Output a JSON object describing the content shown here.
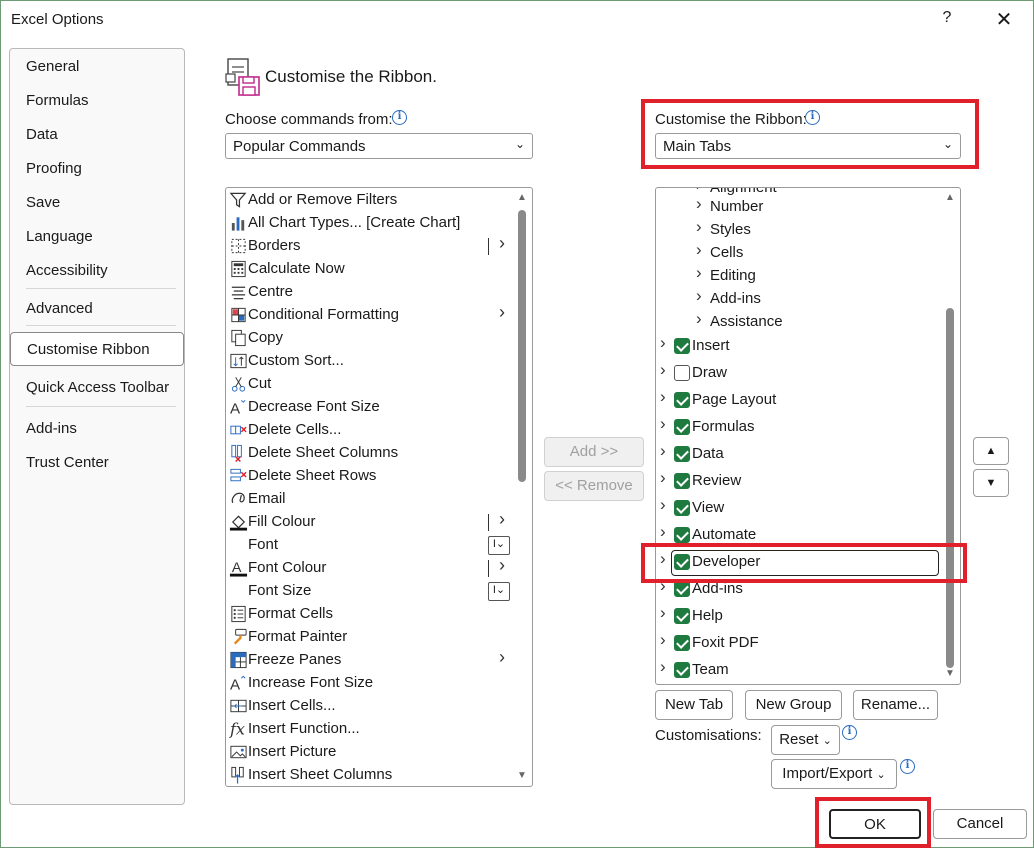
{
  "window": {
    "title": "Excel Options",
    "help": "?",
    "close": "✕"
  },
  "nav": [
    {
      "label": "General",
      "active": false
    },
    {
      "label": "Formulas",
      "active": false
    },
    {
      "label": "Data",
      "active": false
    },
    {
      "label": "Proofing",
      "active": false
    },
    {
      "label": "Save",
      "active": false
    },
    {
      "label": "Language",
      "active": false
    },
    {
      "label": "Accessibility",
      "active": false
    },
    {
      "label": "Advanced",
      "active": false
    },
    {
      "label": "Customise Ribbon",
      "active": true
    },
    {
      "label": "Quick Access Toolbar",
      "active": false
    },
    {
      "label": "Add-ins",
      "active": false
    },
    {
      "label": "Trust Center",
      "active": false
    }
  ],
  "heading": "Customise the Ribbon.",
  "left": {
    "label": "Choose commands from:",
    "dropdown_value": "Popular Commands",
    "commands": [
      {
        "label": "Add or Remove Filters",
        "icon": "filter-icon",
        "suffix": ""
      },
      {
        "label": "All Chart Types... [Create Chart]",
        "icon": "chart-icon",
        "suffix": ""
      },
      {
        "label": "Borders",
        "icon": "borders-icon",
        "suffix": "split-arrow"
      },
      {
        "label": "Calculate Now",
        "icon": "calculator-icon",
        "suffix": ""
      },
      {
        "label": "Centre",
        "icon": "align-center-icon",
        "suffix": ""
      },
      {
        "label": "Conditional Formatting",
        "icon": "conditional-formatting-icon",
        "suffix": "arrow"
      },
      {
        "label": "Copy",
        "icon": "copy-icon",
        "suffix": ""
      },
      {
        "label": "Custom Sort...",
        "icon": "sort-icon",
        "suffix": ""
      },
      {
        "label": "Cut",
        "icon": "scissors-icon",
        "suffix": ""
      },
      {
        "label": "Decrease Font Size",
        "icon": "decrease-font-icon",
        "suffix": ""
      },
      {
        "label": "Delete Cells...",
        "icon": "delete-cells-icon",
        "suffix": ""
      },
      {
        "label": "Delete Sheet Columns",
        "icon": "delete-columns-icon",
        "suffix": ""
      },
      {
        "label": "Delete Sheet Rows",
        "icon": "delete-rows-icon",
        "suffix": ""
      },
      {
        "label": "Email",
        "icon": "email-icon",
        "suffix": ""
      },
      {
        "label": "Fill Colour",
        "icon": "fill-colour-icon",
        "suffix": "split-arrow"
      },
      {
        "label": "Font",
        "icon": "",
        "suffix": "combo"
      },
      {
        "label": "Font Colour",
        "icon": "font-colour-icon",
        "suffix": "split-arrow"
      },
      {
        "label": "Font Size",
        "icon": "",
        "suffix": "combo"
      },
      {
        "label": "Format Cells",
        "icon": "format-cells-icon",
        "suffix": ""
      },
      {
        "label": "Format Painter",
        "icon": "format-painter-icon",
        "suffix": ""
      },
      {
        "label": "Freeze Panes",
        "icon": "freeze-panes-icon",
        "suffix": "arrow"
      },
      {
        "label": "Increase Font Size",
        "icon": "increase-font-icon",
        "suffix": ""
      },
      {
        "label": "Insert Cells...",
        "icon": "insert-cells-icon",
        "suffix": ""
      },
      {
        "label": "Insert Function...",
        "icon": "function-icon",
        "suffix": ""
      },
      {
        "label": "Insert Picture",
        "icon": "picture-icon",
        "suffix": ""
      },
      {
        "label": "Insert Sheet Columns",
        "icon": "insert-columns-icon",
        "suffix": ""
      }
    ]
  },
  "middle": {
    "add": "Add >>",
    "remove": "<< Remove"
  },
  "right": {
    "label": "Customise the Ribbon:",
    "dropdown_value": "Main Tabs",
    "partial_top": "Alignment",
    "groups": [
      "Number",
      "Styles",
      "Cells",
      "Editing",
      "Add-ins",
      "Assistance"
    ],
    "tabs": [
      {
        "label": "Insert",
        "checked": true
      },
      {
        "label": "Draw",
        "checked": false
      },
      {
        "label": "Page Layout",
        "checked": true
      },
      {
        "label": "Formulas",
        "checked": true
      },
      {
        "label": "Data",
        "checked": true
      },
      {
        "label": "Review",
        "checked": true
      },
      {
        "label": "View",
        "checked": true
      },
      {
        "label": "Automate",
        "checked": true
      },
      {
        "label": "Developer",
        "checked": true
      },
      {
        "label": "Add-ins",
        "checked": true
      },
      {
        "label": "Help",
        "checked": true
      },
      {
        "label": "Foxit PDF",
        "checked": true
      },
      {
        "label": "Team",
        "checked": true
      }
    ],
    "new_tab": "New Tab",
    "new_group": "New Group",
    "rename": "Rename...",
    "customisations_label": "Customisations:",
    "reset": "Reset",
    "import_export": "Import/Export"
  },
  "footer": {
    "ok": "OK",
    "cancel": "Cancel"
  },
  "colors": {
    "highlight": "#e0202a",
    "checkbox": "#1f7a3f",
    "info": "#2a6bbf"
  }
}
